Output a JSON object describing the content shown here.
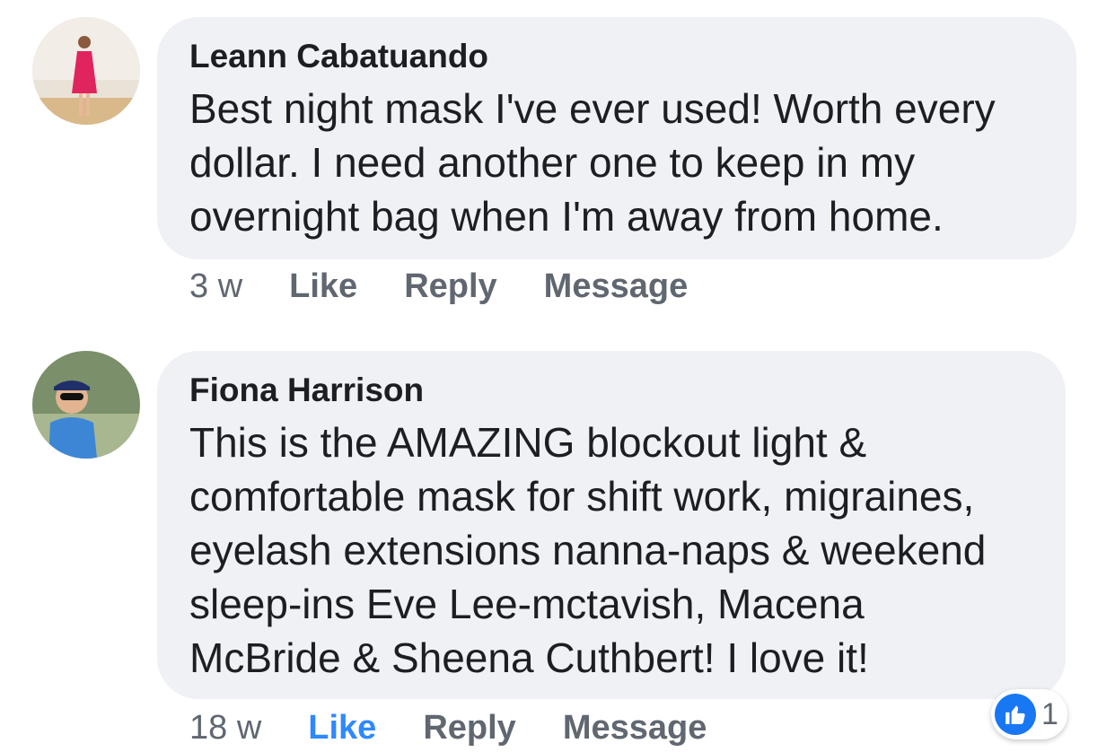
{
  "comments": [
    {
      "author": "Leann Cabatuando",
      "text": "Best night mask I've ever used! Worth every\ndollar. I need another one to keep in my\novernight bag when I'm away from home.",
      "time": "3 w",
      "like_label": "Like",
      "reply_label": "Reply",
      "message_label": "Message",
      "liked": false
    },
    {
      "author": "Fiona Harrison",
      "text": "This is the AMAZING blockout light &\ncomfortable mask for shift work, migraines,\neyelash extensions nanna-naps & weekend\nsleep-ins Eve Lee-mctavish,  Macena\nMcBride & Sheena Cuthbert! I love it!",
      "time": "18 w",
      "like_label": "Like",
      "reply_label": "Reply",
      "message_label": "Message",
      "liked": true,
      "reaction_icon": "thumbs-up-icon",
      "reaction_count": "1"
    }
  ],
  "colors": {
    "bubble": "#eff1f4",
    "text": "#1c1e21",
    "secondary": "#606770",
    "liked": "#2e89ff",
    "like_badge": "#1877f2"
  }
}
